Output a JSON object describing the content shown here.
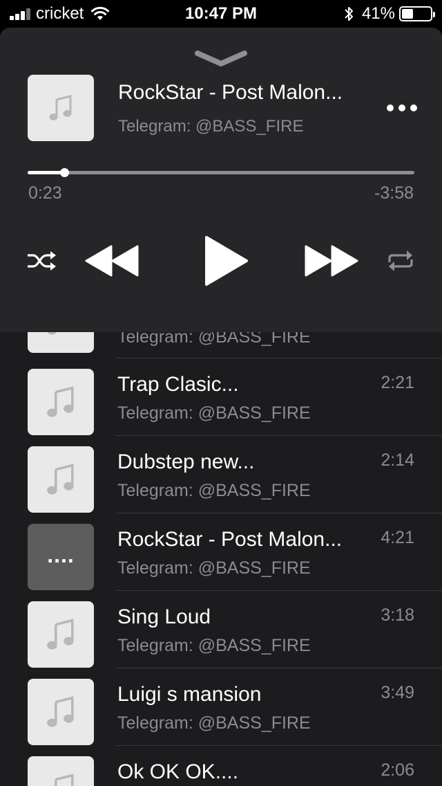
{
  "status_bar": {
    "carrier": "cricket",
    "time": "10:47 PM",
    "battery_percent": "41%",
    "battery_level": 0.41
  },
  "player": {
    "title": "RockStar - Post Malon...",
    "subtitle": "Telegram: @BASS_FIRE",
    "elapsed": "0:23",
    "remaining": "-3:58",
    "progress": 0.094
  },
  "playlist": {
    "partial_subtitle": "Telegram: @BASS_FIRE",
    "items": [
      {
        "title": "Trap Clasic...",
        "subtitle": "Telegram: @BASS_FIRE",
        "duration": "2:21"
      },
      {
        "title": "Dubstep new...",
        "subtitle": "Telegram: @BASS_FIRE",
        "duration": "2:14"
      },
      {
        "title": "RockStar - Post Malon...",
        "subtitle": "Telegram: @BASS_FIRE",
        "duration": "4:21",
        "playing_indicator": "...."
      },
      {
        "title": "Sing Loud",
        "subtitle": "Telegram: @BASS_FIRE",
        "duration": "3:18"
      },
      {
        "title": "Luigi s mansion",
        "subtitle": "Telegram: @BASS_FIRE",
        "duration": "3:49"
      },
      {
        "title": "Ok OK OK....",
        "subtitle": "Telegram: @BASS_FIRE",
        "duration": "2:06"
      }
    ]
  },
  "icons": {
    "collapse": "chevron-down-icon",
    "art": "music-note-icon",
    "more": "more-icon",
    "shuffle": "shuffle-icon",
    "rewind": "rewind-icon",
    "play": "play-icon",
    "forward": "fast-forward-icon",
    "repeat": "repeat-icon"
  },
  "colors": {
    "player_bg": "#262628",
    "list_bg": "#1c1c1e",
    "secondary_text": "#8c8c90",
    "art_placeholder": "#e9e9e9"
  }
}
